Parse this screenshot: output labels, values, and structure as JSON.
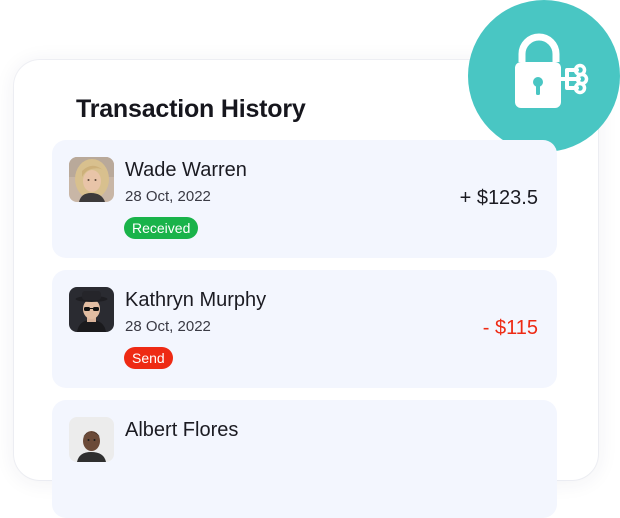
{
  "header": {
    "title": "Transaction History",
    "badge_icon": "lock-network-icon",
    "badge_color": "#49c6c3"
  },
  "transactions": [
    {
      "name": "Wade Warren",
      "date": "28 Oct, 2022",
      "status": "Received",
      "amount": "+ $123.5",
      "status_color": "#19b34a",
      "amount_color": "#1b1b22"
    },
    {
      "name": "Kathryn Murphy",
      "date": "28 Oct, 2022",
      "status": "Send",
      "amount": "- $115",
      "status_color": "#ee2a14",
      "amount_color": "#ee2a14"
    },
    {
      "name": "Albert Flores"
    }
  ]
}
